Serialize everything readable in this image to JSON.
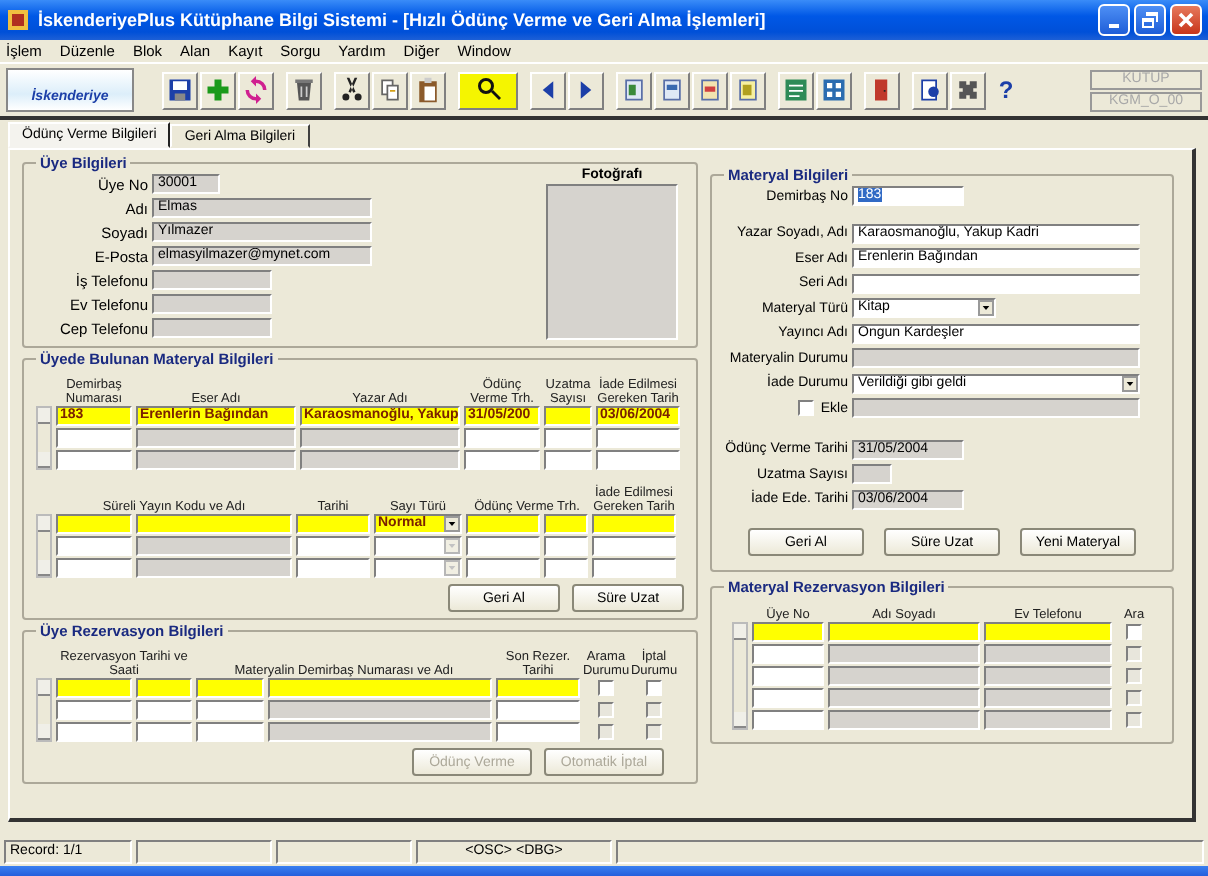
{
  "window": {
    "title": "İskenderiyePlus Kütüphane Bilgi Sistemi - [Hızlı Ödünç Verme ve Geri Alma İşlemleri]"
  },
  "menu": [
    "İşlem",
    "Düzenle",
    "Blok",
    "Alan",
    "Kayıt",
    "Sorgu",
    "Yardım",
    "Diğer",
    "Window"
  ],
  "toolbar": {
    "logo": "İskenderiye",
    "help": "?",
    "fields": [
      "KUTUP",
      "KGM_O_00"
    ]
  },
  "tabs": [
    {
      "label": "Ödünç Verme Bilgileri",
      "selected": true
    },
    {
      "label": "Geri Alma Bilgileri",
      "selected": false
    }
  ],
  "member": {
    "title": "Üye Bilgileri",
    "photo_label": "Fotoğrafı",
    "fields": [
      {
        "label": "Üye No",
        "value": "30001",
        "kind": "short"
      },
      {
        "label": "Adı",
        "value": "Elmas",
        "kind": "long"
      },
      {
        "label": "Soyadı",
        "value": "Yılmazer",
        "kind": "long"
      },
      {
        "label": "E-Posta",
        "value": "elmasyilmazer@mynet.com",
        "kind": "long"
      },
      {
        "label": "İş Telefonu",
        "kind": "medium"
      },
      {
        "label": "Ev Telefonu",
        "kind": "medium"
      },
      {
        "label": "Cep Telefonu",
        "kind": "medium"
      }
    ]
  },
  "loans": {
    "title": "Üyede Bulunan Materyal Bilgileri",
    "book_grid": {
      "columns": [
        {
          "label": "Demirbaş Numarası",
          "kind": "text"
        },
        {
          "label": "Eser Adı",
          "kind": "readonly"
        },
        {
          "label": "Yazar Adı",
          "kind": "readonly"
        },
        {
          "label": "Ödünç Verme Trh.",
          "kind": "text"
        },
        {
          "label": "Uzatma Sayısı",
          "kind": "text"
        },
        {
          "label": "İade Edilmesi Gereken Tarih",
          "kind": "text"
        }
      ],
      "rows": [
        {
          "selected": true,
          "cells": [
            "183",
            "Erenlerin Bağından",
            "Karaosmanoğlu, Yakup",
            "31/05/200",
            null,
            "03/06/2004"
          ]
        },
        {
          "selected": false
        },
        {
          "selected": false
        }
      ]
    },
    "serial_grid": {
      "columns": [
        {
          "label": "Süreli Yayın Kodu ve Adı",
          "kind": "text"
        },
        {
          "kind": "readonly"
        },
        {
          "label": "Tarihi",
          "kind": "text"
        },
        {
          "label": "Sayı Türü",
          "kind": "select"
        },
        {
          "label": "Ödünç Verme Trh.",
          "kind": "text"
        },
        {
          "kind": "text"
        },
        {
          "label": "İade Edilmesi Gereken Tarih",
          "kind": "text"
        }
      ],
      "rows": [
        {
          "selected": true,
          "cells": [
            null,
            null,
            null,
            "Normal",
            null,
            null,
            null
          ]
        },
        {
          "selected": false
        },
        {
          "selected": false
        }
      ]
    },
    "buttons": [
      {
        "label": "Geri Al",
        "disabled": false
      },
      {
        "label": "Süre Uzat",
        "disabled": false
      }
    ]
  },
  "reservations": {
    "title": "Üye Rezervasyon Bilgileri",
    "grid": {
      "columns": [
        {
          "label": "Rezervasyon Tarihi ve Saati",
          "kind": "text"
        },
        {
          "kind": "text"
        },
        {
          "label": "Materyalin Demirbaş Numarası ve Adı",
          "kind": "text"
        },
        {
          "kind": "readonly"
        },
        {
          "label": "Son Rezer. Tarihi",
          "kind": "text"
        },
        {
          "label": "Arama Durumu",
          "kind": "check"
        },
        {
          "label": "İptal Durumu",
          "kind": "check"
        }
      ],
      "rows": [
        {
          "selected": true,
          "cells": [
            null,
            null,
            null,
            null,
            null,
            false,
            false
          ]
        },
        {
          "selected": false,
          "cells": [
            null,
            null,
            null,
            null,
            null,
            false,
            false
          ]
        },
        {
          "selected": false,
          "cells": [
            null,
            null,
            null,
            null,
            null,
            false,
            false
          ]
        }
      ]
    },
    "buttons": [
      {
        "label": "Ödünç Verme",
        "disabled": true
      },
      {
        "label": "Otomatik İptal",
        "disabled": true
      }
    ]
  },
  "material": {
    "title": "Materyal Bilgileri",
    "fields": [
      {
        "label": "Demirbaş No",
        "value": "183",
        "kind": "short-input",
        "text_selected": true
      },
      {
        "label": "Yazar Soyadı, Adı",
        "value": "Karaosmanoğlu, Yakup Kadri",
        "kind": "input"
      },
      {
        "label": "Eser Adı",
        "value": "Erenlerin Bağından",
        "kind": "input"
      },
      {
        "label": "Seri Adı",
        "kind": "input"
      },
      {
        "label": "Materyal Türü",
        "value": "Kitap",
        "kind": "short-select"
      },
      {
        "label": "Yayıncı Adı",
        "value": "Ongun Kardeşler",
        "kind": "input"
      },
      {
        "label": "Materyalin Durumu",
        "kind": "readonly"
      },
      {
        "label": "İade Durumu",
        "value": "Verildiği gibi geldi",
        "kind": "select"
      },
      {
        "label": "Ekle",
        "kind": "check",
        "checked": false
      }
    ],
    "dates": [
      {
        "label": "Ödünç Verme Tarihi",
        "value": "31/05/2004",
        "kind": "date"
      },
      {
        "label": "Uzatma Sayısı",
        "kind": "count"
      },
      {
        "label": "İade Ede. Tarihi",
        "value": "03/06/2004",
        "kind": "date"
      }
    ],
    "buttons": [
      {
        "label": "Geri Al",
        "disabled": false
      },
      {
        "label": "Süre Uzat",
        "disabled": false
      },
      {
        "label": "Yeni Materyal",
        "disabled": false
      }
    ]
  },
  "material_reservations": {
    "title": "Materyal Rezervasyon Bilgileri",
    "grid": {
      "columns": [
        {
          "label": "Üye No",
          "kind": "text"
        },
        {
          "label": "Adı Soyadı",
          "kind": "readonly"
        },
        {
          "label": "Ev Telefonu",
          "kind": "readonly"
        },
        {
          "label": "Ara",
          "kind": "check"
        }
      ],
      "rows": [
        {
          "selected": true,
          "cells": [
            null,
            null,
            null,
            false
          ]
        },
        {
          "selected": false,
          "cells": [
            null,
            null,
            null,
            false
          ]
        },
        {
          "selected": false,
          "cells": [
            null,
            null,
            null,
            false
          ]
        },
        {
          "selected": false,
          "cells": [
            null,
            null,
            null,
            false
          ]
        },
        {
          "selected": false,
          "cells": [
            null,
            null,
            null,
            false
          ]
        }
      ]
    }
  },
  "status_bar": [
    "Record: 1/1",
    "<OSC>",
    "<DBG>"
  ]
}
